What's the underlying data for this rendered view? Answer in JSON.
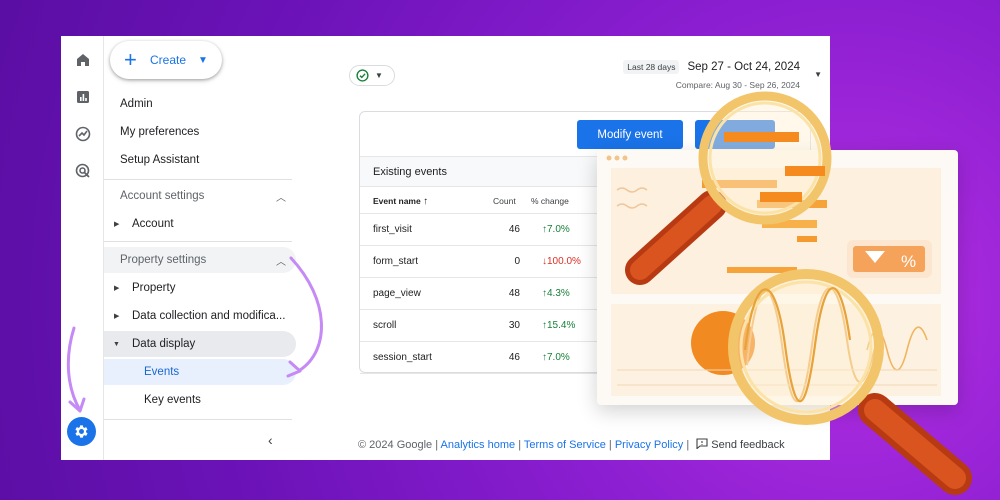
{
  "create": {
    "label": "Create"
  },
  "nav": {
    "admin": "Admin",
    "my_preferences": "My preferences",
    "setup_assistant": "Setup Assistant",
    "account_settings": "Account settings",
    "account": "Account",
    "property_settings": "Property settings",
    "property": "Property",
    "data_collection": "Data collection and modifica...",
    "data_display": "Data display",
    "events": "Events",
    "key_events": "Key events"
  },
  "date": {
    "chip": "Last 28 days",
    "range": "Sep 27 - Oct 24, 2024",
    "compare": "Compare: Aug 30 - Sep 26, 2024"
  },
  "card": {
    "modify_button": "Modify event",
    "title": "Existing events",
    "columns": [
      "Event name",
      "Count",
      "% change"
    ],
    "rows": [
      {
        "name": "first_visit",
        "count": "46",
        "change": "7.0%",
        "direction": "up"
      },
      {
        "name": "form_start",
        "count": "0",
        "change": "100.0%",
        "direction": "down"
      },
      {
        "name": "page_view",
        "count": "48",
        "change": "4.3%",
        "direction": "up"
      },
      {
        "name": "scroll",
        "count": "30",
        "change": "15.4%",
        "direction": "up"
      },
      {
        "name": "session_start",
        "count": "46",
        "change": "7.0%",
        "direction": "up"
      }
    ]
  },
  "footer": {
    "copyright": "© 2024 Google |",
    "analytics_home": "Analytics home",
    "sep1": "|",
    "terms": "Terms of Service",
    "sep2": "|",
    "privacy": "Privacy Policy",
    "sep3": "|",
    "feedback": "Send feedback"
  },
  "illustration": {
    "percent_symbol": "%"
  },
  "colors": {
    "accent": "#1a73e8",
    "up": "#188038",
    "down": "#d93025",
    "background": "#7a18c4",
    "arrow": "#c58af5"
  },
  "icons": [
    "home-icon",
    "reports-icon",
    "explore-icon",
    "advertising-icon",
    "gear-icon",
    "check-circle-icon",
    "plus-icon",
    "sort-arrow-icon",
    "feedback-icon",
    "chevron-left-icon",
    "magnifier-icon"
  ]
}
